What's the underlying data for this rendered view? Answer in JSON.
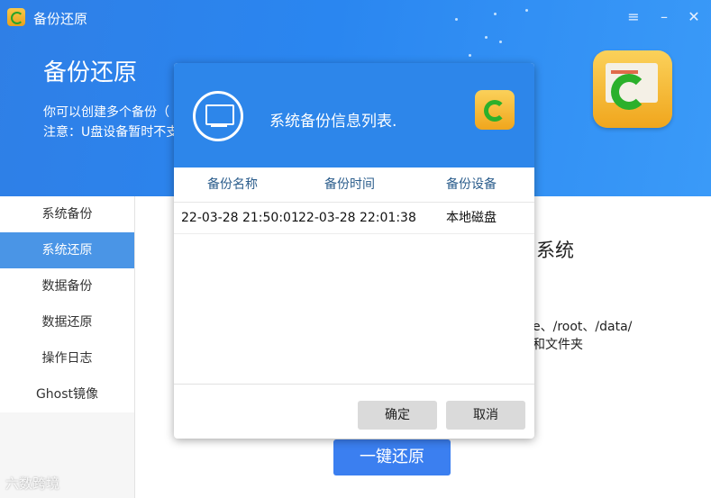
{
  "window": {
    "title": "备份还原",
    "controls": {
      "menu": "≡",
      "minimize": "–",
      "close": "✕"
    }
  },
  "hero": {
    "title": "备份还原",
    "line1": "你可以创建多个备份（",
    "line2": "注意：U盘设备暂时不支"
  },
  "sidebar": {
    "items": [
      {
        "label": "系统备份"
      },
      {
        "label": "系统还原",
        "active": true
      },
      {
        "label": "数据备份"
      },
      {
        "label": "数据还原"
      },
      {
        "label": "操作日志"
      },
      {
        "label": "Ghost镜像"
      }
    ]
  },
  "background_content": {
    "heading_tail": "系统",
    "paths_tail": "e、/root、/data/",
    "folders_tail": "和文件夹",
    "restore_button": "一键还原"
  },
  "dialog": {
    "title": "系统备份信息列表.",
    "columns": [
      "备份名称",
      "备份时间",
      "备份设备"
    ],
    "rows": [
      {
        "name": "22-03-28 21:50:01",
        "time": "22-03-28 22:01:38",
        "device": "本地磁盘"
      }
    ],
    "ok": "确定",
    "cancel": "取消"
  },
  "watermark": "六数跨境",
  "colors": {
    "header": "#2f7fe6",
    "accent": "#3b7ff0",
    "sidebar_active": "#4a95e6"
  }
}
